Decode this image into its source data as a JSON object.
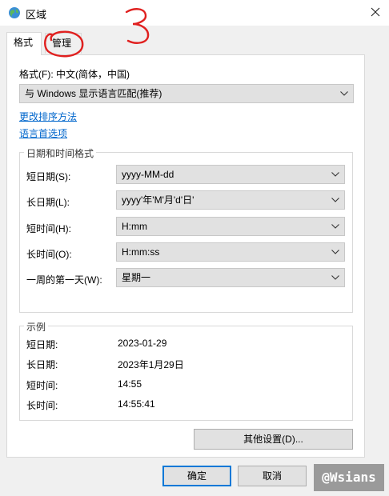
{
  "window": {
    "title": "区域",
    "icons": {
      "app": "globe-icon",
      "close": "close-icon"
    }
  },
  "tabs": [
    {
      "label": "格式",
      "selected": true
    },
    {
      "label": "管理",
      "selected": false
    }
  ],
  "format": {
    "label": "格式(F): 中文(简体，中国)",
    "select_value": "与 Windows 显示语言匹配(推荐)",
    "link_sort": "更改排序方法",
    "link_language": "语言首选项"
  },
  "datetime": {
    "group_title": "日期和时间格式",
    "rows": [
      {
        "label": "短日期(S):",
        "value": "yyyy-MM-dd"
      },
      {
        "label": "长日期(L):",
        "value": "yyyy'年'M'月'd'日'"
      },
      {
        "label": "短时间(H):",
        "value": "H:mm"
      },
      {
        "label": "长时间(O):",
        "value": "H:mm:ss"
      },
      {
        "label": "一周的第一天(W):",
        "value": "星期一"
      }
    ]
  },
  "example": {
    "group_title": "示例",
    "rows": [
      {
        "label": "短日期:",
        "value": "2023-01-29"
      },
      {
        "label": "长日期:",
        "value": "2023年1月29日"
      },
      {
        "label": "短时间:",
        "value": "14:55"
      },
      {
        "label": "长时间:",
        "value": "14:55:41"
      }
    ]
  },
  "buttons": {
    "other_settings": "其他设置(D)...",
    "ok": "确定",
    "cancel": "取消"
  },
  "annotation": {
    "number": "3"
  },
  "watermark": "@Wsians",
  "colors": {
    "link": "#0066cc",
    "primary_border": "#0078d7",
    "annotation": "#e0201f"
  }
}
